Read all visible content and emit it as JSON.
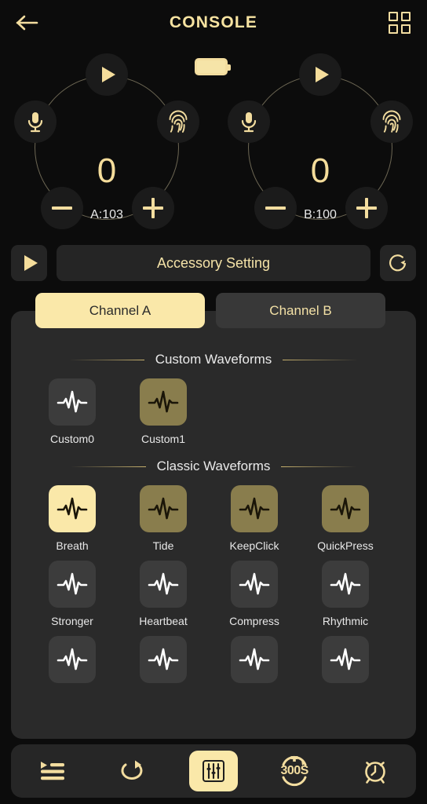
{
  "header": {
    "title": "CONSOLE",
    "back_icon": "arrow-left-icon",
    "grid_icon": "grid-2x2-icon"
  },
  "status": {
    "battery_icon": "battery-full-icon"
  },
  "channels": [
    {
      "id": "a",
      "value": "0",
      "label": "A:103",
      "play_icon": "play-icon",
      "mic_icon": "microphone-icon",
      "fingerprint_icon": "fingerprint-icon",
      "minus_label": "minus",
      "plus_label": "plus"
    },
    {
      "id": "b",
      "value": "0",
      "label": "B:100",
      "play_icon": "play-icon",
      "mic_icon": "microphone-icon",
      "fingerprint_icon": "fingerprint-icon",
      "minus_label": "minus",
      "plus_label": "plus"
    }
  ],
  "accessory": {
    "play_icon": "play-icon",
    "title": "Accessory Setting",
    "refresh_icon": "refresh-circle-icon"
  },
  "tabs": [
    {
      "label": "Channel A",
      "active": true
    },
    {
      "label": "Channel B",
      "active": false
    }
  ],
  "sections": [
    {
      "title": "Custom Waveforms",
      "items": [
        {
          "label": "Custom0",
          "state": "idle"
        },
        {
          "label": "Custom1",
          "state": "avail"
        }
      ]
    },
    {
      "title": "Classic Waveforms",
      "items": [
        {
          "label": "Breath",
          "state": "selected"
        },
        {
          "label": "Tide",
          "state": "avail"
        },
        {
          "label": "KeepClick",
          "state": "avail"
        },
        {
          "label": "QuickPress",
          "state": "avail"
        },
        {
          "label": "Stronger",
          "state": "idle"
        },
        {
          "label": "Heartbeat",
          "state": "idle"
        },
        {
          "label": "Compress",
          "state": "idle"
        },
        {
          "label": "Rhythmic",
          "state": "idle"
        },
        {
          "label": "",
          "state": "idle"
        },
        {
          "label": "",
          "state": "idle"
        },
        {
          "label": "",
          "state": "idle"
        },
        {
          "label": "",
          "state": "idle"
        }
      ]
    }
  ],
  "bottom_nav": [
    {
      "icon": "playlist-icon",
      "label": "",
      "active": false
    },
    {
      "icon": "loop-icon",
      "label": "",
      "active": false
    },
    {
      "icon": "equalizer-icon",
      "label": "",
      "active": true
    },
    {
      "icon": "stopwatch-icon",
      "label": "300S",
      "active": false
    },
    {
      "icon": "alarm-clock-icon",
      "label": "",
      "active": false
    }
  ],
  "colors": {
    "gold": "#f3dd9f",
    "gold_bright": "#fae8a9",
    "olive": "#897d4d",
    "tile_idle": "#3c3c3c",
    "background": "#0c0c0c",
    "card": "#2a2a2a"
  }
}
